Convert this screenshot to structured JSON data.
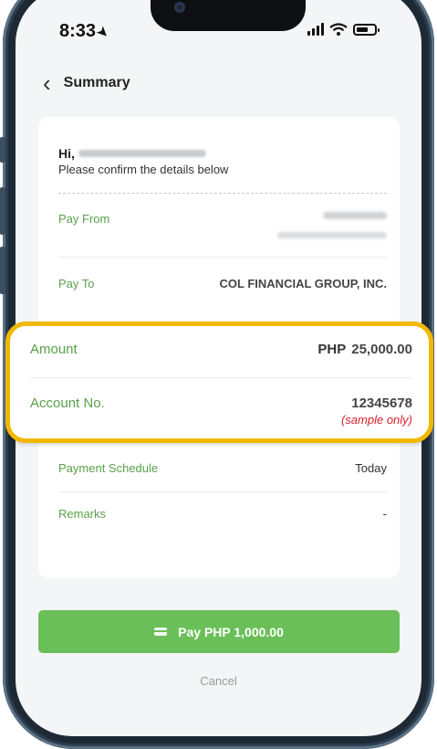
{
  "status_bar": {
    "time": "8:33"
  },
  "header": {
    "back_icon": "chevron-left-icon",
    "title": "Summary"
  },
  "greeting": {
    "hi": "Hi,",
    "instruction": "Please confirm the details below"
  },
  "details": {
    "pay_from_label": "Pay From",
    "pay_to_label": "Pay To",
    "pay_to_value": "COL FINANCIAL GROUP, INC.",
    "payment_schedule_label": "Payment Schedule",
    "payment_schedule_value": "Today",
    "remarks_label": "Remarks",
    "remarks_value": "-"
  },
  "highlight": {
    "color": "#f2b800",
    "amount_label": "Amount",
    "amount_currency": "PHP",
    "amount_value": "25,000.00",
    "account_label": "Account No.",
    "account_value": "12345678",
    "account_note": "(sample only)"
  },
  "actions": {
    "pay_label": "Pay PHP 1,000.00",
    "pay_icon": "card-icon",
    "cancel_label": "Cancel"
  },
  "colors": {
    "accent": "#6bbf59",
    "label_green": "#5aa04a",
    "note_red": "#d9202a"
  }
}
